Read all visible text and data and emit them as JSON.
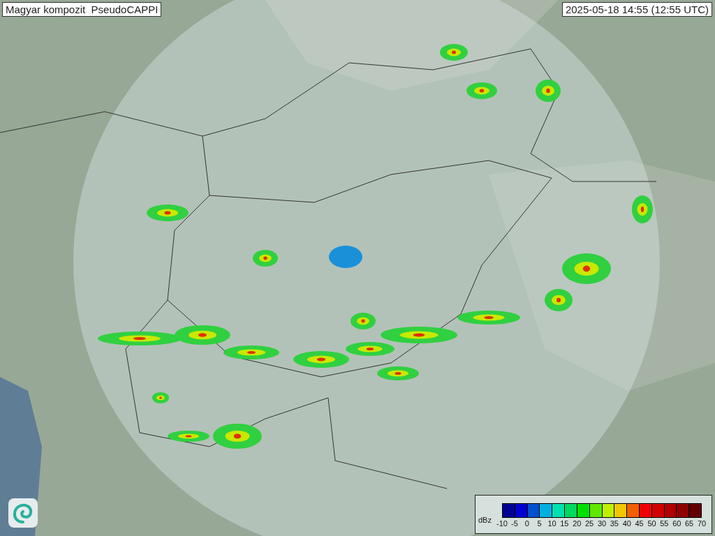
{
  "title": "Magyar kompozit  PseudoCAPPI",
  "timestamp": "2025-05-18 14:55 (12:55 UTC)",
  "legend": {
    "unit": "dBz",
    "bins": [
      {
        "color": "#000090"
      },
      {
        "color": "#0000d0"
      },
      {
        "color": "#0050d0"
      },
      {
        "color": "#00b0e0"
      },
      {
        "color": "#00e0b0"
      },
      {
        "color": "#00d860"
      },
      {
        "color": "#00e000"
      },
      {
        "color": "#60e800"
      },
      {
        "color": "#c0f000"
      },
      {
        "color": "#f0c800"
      },
      {
        "color": "#f06000"
      },
      {
        "color": "#f00000"
      },
      {
        "color": "#d00000"
      },
      {
        "color": "#b00000"
      },
      {
        "color": "#900000"
      },
      {
        "color": "#600000"
      }
    ],
    "ticks": [
      "-10",
      "-5",
      "0",
      "5",
      "10",
      "15",
      "20",
      "25",
      "30",
      "35",
      "40",
      "45",
      "50",
      "55",
      "60",
      "65",
      "70"
    ]
  }
}
